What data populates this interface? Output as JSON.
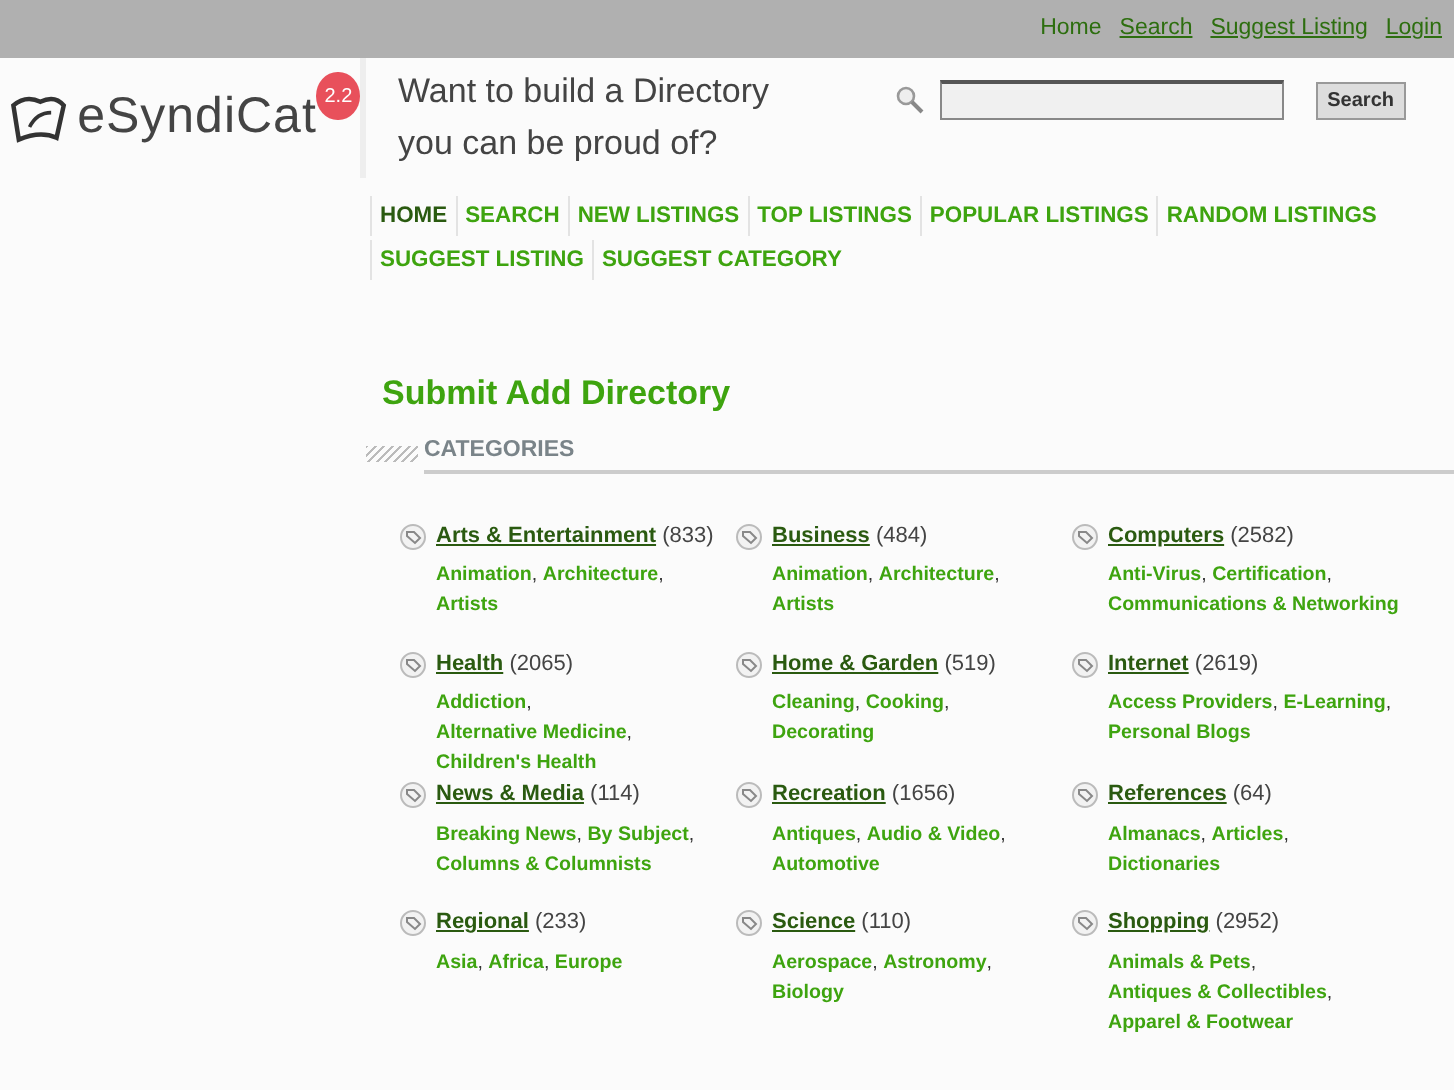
{
  "top_links": [
    {
      "label": "Home",
      "selected": true
    },
    {
      "label": "Search",
      "selected": false
    },
    {
      "label": "Suggest Listing",
      "selected": false
    },
    {
      "label": "Login",
      "selected": false
    }
  ],
  "logo": {
    "text": "eSyndiCat",
    "version": "2.2"
  },
  "tagline": "Want to build a Directory you can be proud of?",
  "search": {
    "button": "Search"
  },
  "nav": [
    {
      "label": "HOME",
      "selected": true
    },
    {
      "label": "SEARCH",
      "selected": false
    },
    {
      "label": "NEW LISTINGS",
      "selected": false
    },
    {
      "label": "TOP LISTINGS",
      "selected": false
    },
    {
      "label": "POPULAR LISTINGS",
      "selected": false
    },
    {
      "label": "RANDOM LISTINGS",
      "selected": false
    },
    {
      "label": "SUGGEST LISTING",
      "selected": false
    },
    {
      "label": "SUGGEST CATEGORY",
      "selected": false
    }
  ],
  "page_title": "Submit Add Directory",
  "section_title": "CATEGORIES",
  "subcategory_separator": ",",
  "categories": [
    {
      "name": "Arts & Entertainment",
      "count": "(833)",
      "subcategories": [
        "Animation",
        "Architecture",
        "Artists"
      ]
    },
    {
      "name": "Business",
      "count": "(484)",
      "subcategories": [
        "Animation",
        "Architecture",
        "Artists"
      ]
    },
    {
      "name": "Computers",
      "count": "(2582)",
      "subcategories": [
        "Anti-Virus",
        "Certification",
        "Communications & Networking"
      ]
    },
    {
      "name": "Health",
      "count": "(2065)",
      "subcategories": [
        "Addiction",
        "Alternative Medicine",
        "Children's Health"
      ]
    },
    {
      "name": "Home & Garden",
      "count": "(519)",
      "subcategories": [
        "Cleaning",
        "Cooking",
        "Decorating"
      ]
    },
    {
      "name": "Internet",
      "count": "(2619)",
      "subcategories": [
        "Access Providers",
        "E-Learning",
        "Personal Blogs"
      ]
    },
    {
      "name": "News & Media",
      "count": "(114)",
      "subcategories": [
        "Breaking News",
        "By Subject",
        "Columns & Columnists"
      ]
    },
    {
      "name": "Recreation",
      "count": "(1656)",
      "subcategories": [
        "Antiques",
        "Audio & Video",
        "Automotive"
      ]
    },
    {
      "name": "References",
      "count": "(64)",
      "subcategories": [
        "Almanacs",
        "Articles",
        "Dictionaries"
      ]
    },
    {
      "name": "Regional",
      "count": "(233)",
      "subcategories": [
        "Asia",
        "Africa",
        "Europe"
      ]
    },
    {
      "name": "Science",
      "count": "(110)",
      "subcategories": [
        "Aerospace",
        "Astronomy",
        "Biology"
      ]
    },
    {
      "name": "Shopping",
      "count": "(2952)",
      "subcategories": [
        "Animals & Pets",
        "Antiques & Collectibles",
        "Apparel & Footwear"
      ]
    }
  ]
}
